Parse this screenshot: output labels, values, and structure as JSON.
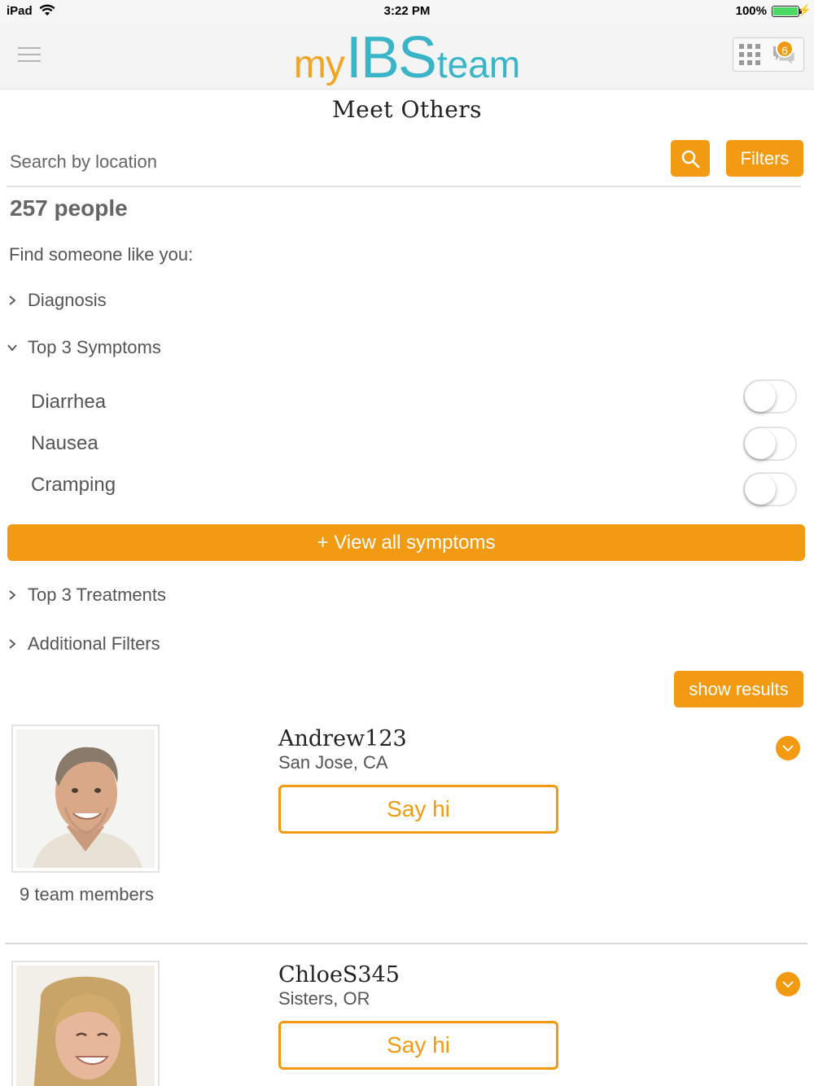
{
  "status_bar": {
    "carrier": "iPad",
    "time": "3:22 PM",
    "battery": "100%"
  },
  "header": {
    "logo_my": "my",
    "logo_brand": "IBS",
    "logo_team": "team",
    "notification_count": "6"
  },
  "page": {
    "title": "Meet Others"
  },
  "search": {
    "placeholder": "Search by location",
    "filters_label": "Filters"
  },
  "results": {
    "count_label": "257 people",
    "find_label": "Find someone like you:"
  },
  "filters": {
    "sections": [
      {
        "label": "Diagnosis",
        "expanded": false
      },
      {
        "label": "Top 3 Symptoms",
        "expanded": true
      },
      {
        "label": "Top 3 Treatments",
        "expanded": false
      },
      {
        "label": "Additional Filters",
        "expanded": false
      }
    ],
    "symptoms": [
      {
        "label": "Diarrhea",
        "on": false
      },
      {
        "label": "Nausea",
        "on": false
      },
      {
        "label": "Cramping",
        "on": false
      }
    ],
    "view_all_label": "+ View all symptoms",
    "show_results_label": "show results"
  },
  "members": [
    {
      "name": "Andrew123",
      "location": "San Jose, CA",
      "say_hi_label": "Say hi",
      "team_count_label": "9 team members"
    },
    {
      "name": "ChloeS345",
      "location": "Sisters, OR",
      "say_hi_label": "Say hi"
    }
  ],
  "colors": {
    "accent": "#f29b12",
    "brand_teal": "#3ab5c8"
  }
}
